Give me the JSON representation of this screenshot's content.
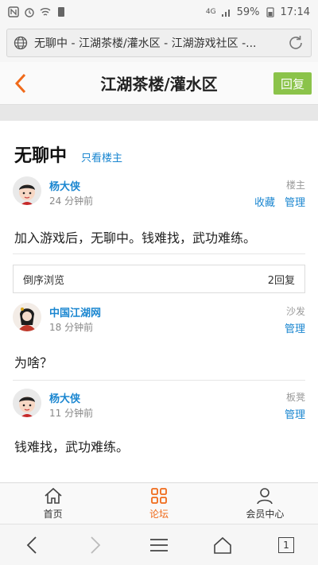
{
  "statusbar": {
    "battery": "59%",
    "time": "17:14",
    "network": "4G"
  },
  "browser": {
    "url_text": "无聊中 - 江湖茶楼/灌水区 - 江湖游戏社区 -..."
  },
  "header": {
    "title": "江湖茶楼/灌水区",
    "reply_label": "回复"
  },
  "thread": {
    "title": "无聊中",
    "only_op_label": "只看楼主"
  },
  "posts": [
    {
      "author": "杨大侠",
      "time": "24 分钟前",
      "floor": "楼主",
      "actions": [
        "收藏",
        "管理"
      ],
      "body": "加入游戏后，无聊中。钱难找，武功难练。"
    },
    {
      "author": "中国江湖网",
      "time": "18 分钟前",
      "floor": "沙发",
      "actions": [
        "管理"
      ],
      "body": "为啥？"
    },
    {
      "author": "杨大侠",
      "time": "11 分钟前",
      "floor": "板凳",
      "actions": [
        "管理"
      ],
      "body": "钱难找，武功难练。"
    }
  ],
  "sortbar": {
    "label": "倒序浏览",
    "count": "2回复"
  },
  "tabbar": {
    "items": [
      {
        "label": "首页"
      },
      {
        "label": "论坛"
      },
      {
        "label": "会员中心"
      }
    ],
    "active": "论坛"
  },
  "browser_nav": {
    "tabs_count": "1"
  },
  "colors": {
    "accent_orange": "#f06a1a",
    "link_blue": "#1a86d0",
    "reply_green": "#8bc34a"
  },
  "icons": [
    "globe-icon",
    "refresh-icon",
    "back-arrow-icon",
    "home-icon",
    "grid-icon",
    "user-icon",
    "scroll-down-icon"
  ]
}
